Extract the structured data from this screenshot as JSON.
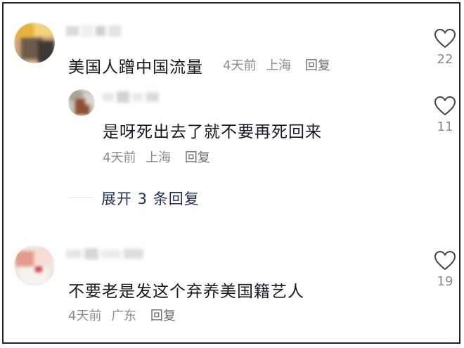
{
  "comments": [
    {
      "text": "美国人蹭中国流量",
      "time": "4天前",
      "location": "上海",
      "reply_label": "回复",
      "likes": "22"
    },
    {
      "text": "是呀死出去了就不要再死回来",
      "time": "4天前",
      "location": "上海",
      "reply_label": "回复",
      "likes": "11"
    },
    {
      "text": "不要老是发这个弃养美国籍艺人",
      "time": "4天前",
      "location": "广东",
      "reply_label": "回复",
      "likes": "19"
    }
  ],
  "expand_replies_label": "展开 3 条回复",
  "icons": {
    "like": "heart-outline-icon"
  },
  "colors": {
    "text": "#161823",
    "meta": "#8a8b91",
    "expand": "#1f2e54"
  }
}
